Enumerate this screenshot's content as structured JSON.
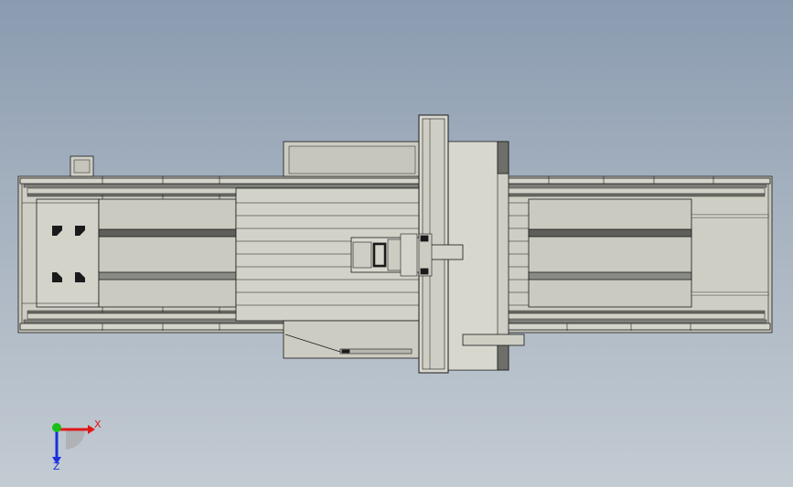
{
  "viewport": {
    "background_top": "#8a9bb0",
    "background_bottom": "#c3cbd3"
  },
  "model": {
    "part_fill": "#c9c8bd",
    "part_fill_light": "#d9d8cf",
    "part_dark": "#6f6f69",
    "edge_color": "#1a1a1a"
  },
  "triad": {
    "x_label": "X",
    "z_label": "Z",
    "x_color": "#e01818",
    "y_color": "#18c018",
    "z_color": "#1830e0"
  }
}
